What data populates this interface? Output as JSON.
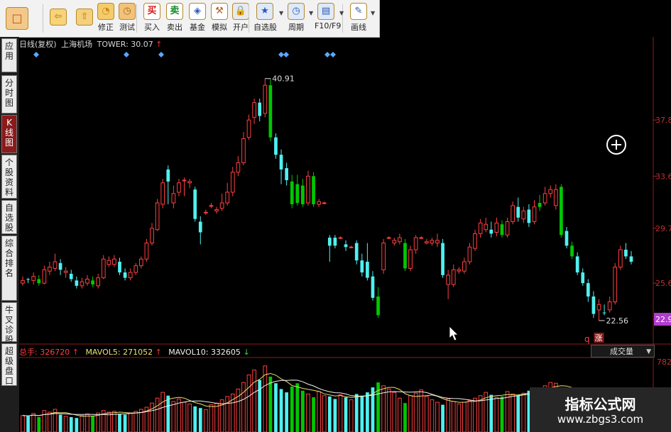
{
  "toolbar": {
    "buttons": [
      {
        "label": "",
        "icon": "home-icon"
      },
      {
        "label": "",
        "icon": "back-arrow-icon"
      },
      {
        "label": "",
        "icon": "up-down-arrows-icon"
      },
      {
        "label": "修正",
        "icon": "correct-icon"
      },
      {
        "label": "测试",
        "icon": "test-clock-icon"
      },
      {
        "label": "买入",
        "icon": "buy-icon"
      },
      {
        "label": "卖出",
        "icon": "sell-icon"
      },
      {
        "label": "基金",
        "icon": "fund-icon"
      },
      {
        "label": "模拟",
        "icon": "simulate-hammer-icon"
      },
      {
        "label": "开户",
        "icon": "lock-icon"
      },
      {
        "label": "自选股",
        "icon": "favorites-icon"
      },
      {
        "label": "周期",
        "icon": "period-icon"
      },
      {
        "label": "F10/F9",
        "icon": "f10-icon"
      },
      {
        "label": "画线",
        "icon": "pen-icon"
      }
    ]
  },
  "sidetabs": [
    {
      "label": "应用"
    },
    {
      "label": "分时图"
    },
    {
      "label": "K线图"
    },
    {
      "label": "个股资料"
    },
    {
      "label": "自选股"
    },
    {
      "label": "综合排名"
    },
    {
      "label": "牛叉诊股"
    },
    {
      "label": "超级盘口"
    }
  ],
  "chart_header": {
    "period_label": "日线(复权)",
    "stock_name": "上海机场",
    "indicator_text": "TOWER: 30.07",
    "indicator_arrow": "↑"
  },
  "price_axis": {
    "labels": [
      "37.8",
      "33.6",
      "29.7",
      "25.6",
      "22.9"
    ],
    "current_price_color": "#b23ccf"
  },
  "annotations": {
    "high_label": "40.91",
    "low_label": "22.56",
    "up_marker": "涨",
    "q_marker": "q"
  },
  "volume_header": {
    "total_label": "总手:",
    "total_value": "326720",
    "total_arrow": "↑",
    "mavol5_label": "MAVOL5:",
    "mavol5_value": "271052",
    "mavol5_arrow": "↑",
    "mavol10_label": "MAVOL10:",
    "mavol10_value": "332605",
    "mavol10_arrow": "↓",
    "dropdown": "成交量",
    "axis_value": "782"
  },
  "watermark": {
    "title": "指标公式网",
    "url": "www.zbgs3.com"
  },
  "colors": {
    "up": "#ff4040",
    "down_cyan": "#50f0f0",
    "down_green": "#00c800",
    "ma_yellow": "#e8e070",
    "ma_white": "#f0f0f0"
  },
  "chart_data": {
    "type": "candlestick",
    "ylim": [
      22,
      42
    ],
    "candles": [
      [
        25.6,
        25.8,
        26.1,
        25.4,
        "red"
      ],
      [
        25.9,
        25.9,
        26.0,
        25.6,
        "cyan"
      ],
      [
        25.8,
        26.1,
        26.4,
        25.5,
        "red"
      ],
      [
        25.9,
        25.6,
        26.2,
        25.4,
        "green"
      ],
      [
        25.6,
        26.6,
        26.9,
        25.5,
        "red"
      ],
      [
        26.5,
        26.8,
        27.2,
        26.2,
        "red"
      ],
      [
        26.7,
        27.2,
        27.8,
        26.5,
        "red"
      ],
      [
        27.1,
        26.6,
        27.4,
        26.2,
        "cyan"
      ],
      [
        26.5,
        26.4,
        26.8,
        26.0,
        "red"
      ],
      [
        26.3,
        25.9,
        26.6,
        25.7,
        "cyan"
      ],
      [
        25.8,
        25.4,
        26.1,
        25.2,
        "cyan"
      ],
      [
        25.4,
        25.7,
        26.0,
        25.2,
        "red"
      ],
      [
        25.6,
        25.9,
        26.2,
        25.4,
        "red"
      ],
      [
        25.8,
        25.5,
        26.1,
        25.3,
        "green"
      ],
      [
        25.4,
        26.0,
        26.3,
        25.2,
        "red"
      ],
      [
        26.0,
        27.4,
        27.7,
        25.9,
        "red"
      ],
      [
        27.3,
        27.0,
        27.6,
        26.8,
        "red"
      ],
      [
        27.0,
        27.4,
        27.7,
        26.8,
        "red"
      ],
      [
        27.2,
        26.4,
        27.5,
        26.2,
        "cyan"
      ],
      [
        26.4,
        26.0,
        26.7,
        25.8,
        "cyan"
      ],
      [
        26.0,
        26.4,
        26.7,
        25.8,
        "red"
      ],
      [
        26.4,
        26.9,
        27.1,
        26.2,
        "red"
      ],
      [
        26.9,
        27.4,
        27.6,
        26.7,
        "red"
      ],
      [
        27.4,
        28.6,
        28.9,
        27.2,
        "red"
      ],
      [
        28.6,
        29.7,
        30.1,
        28.4,
        "red"
      ],
      [
        29.6,
        31.6,
        31.9,
        29.5,
        "red"
      ],
      [
        31.5,
        33.1,
        33.4,
        31.2,
        "red"
      ],
      [
        33.2,
        34.1,
        34.4,
        31.5,
        "cyan"
      ],
      [
        32.3,
        31.6,
        32.9,
        31.2,
        "red"
      ],
      [
        32.4,
        33.1,
        33.4,
        32.1,
        "red"
      ],
      [
        33.3,
        33.3,
        33.5,
        32.1,
        "red"
      ],
      [
        33.2,
        33.1,
        33.4,
        32.7,
        "red"
      ],
      [
        32.6,
        30.4,
        32.8,
        30.2,
        "cyan"
      ],
      [
        30.2,
        29.4,
        30.6,
        28.5,
        "cyan"
      ],
      [
        30.9,
        30.9,
        31.1,
        30.7,
        "red"
      ],
      [
        31.4,
        31.4,
        31.6,
        31.2,
        "red"
      ],
      [
        31.0,
        31.1,
        31.3,
        30.8,
        "red"
      ],
      [
        31.2,
        31.6,
        32.3,
        31.0,
        "red"
      ],
      [
        31.6,
        32.4,
        33.1,
        31.4,
        "red"
      ],
      [
        32.4,
        33.9,
        34.3,
        32.1,
        "red"
      ],
      [
        33.9,
        34.6,
        35.1,
        33.6,
        "red"
      ],
      [
        34.6,
        36.4,
        36.9,
        34.4,
        "red"
      ],
      [
        36.5,
        37.8,
        38.2,
        36.3,
        "red"
      ],
      [
        38.0,
        39.1,
        39.4,
        37.5,
        "red"
      ],
      [
        39.1,
        38.1,
        39.4,
        37.7,
        "cyan"
      ],
      [
        38.3,
        40.4,
        40.9,
        38.0,
        "red"
      ],
      [
        40.4,
        36.5,
        40.9,
        36.2,
        "green"
      ],
      [
        36.5,
        35.2,
        36.8,
        34.9,
        "cyan"
      ],
      [
        35.2,
        34.1,
        35.6,
        33.0,
        "cyan"
      ],
      [
        34.2,
        33.3,
        34.6,
        32.9,
        "cyan"
      ],
      [
        33.2,
        31.5,
        33.7,
        31.2,
        "green"
      ],
      [
        31.6,
        33.0,
        33.7,
        31.4,
        "green"
      ],
      [
        32.9,
        31.5,
        33.4,
        31.3,
        "green"
      ],
      [
        31.6,
        33.6,
        34.0,
        31.4,
        "red"
      ],
      [
        33.6,
        31.5,
        33.9,
        31.3,
        "green"
      ],
      [
        31.5,
        31.7,
        31.9,
        31.3,
        "red"
      ],
      [
        31.6,
        31.6,
        31.7,
        31.5,
        "red"
      ],
      [
        29.0,
        28.4,
        29.2,
        27.2,
        "cyan"
      ],
      [
        28.4,
        29.0,
        29.2,
        28.2,
        "cyan"
      ],
      [
        29.0,
        29.0,
        29.1,
        28.9,
        "red"
      ],
      [
        28.5,
        28.3,
        28.8,
        28.0,
        "cyan"
      ],
      [
        28.3,
        28.3,
        28.4,
        28.2,
        "red"
      ],
      [
        28.6,
        27.3,
        28.8,
        27.0,
        "cyan"
      ],
      [
        27.3,
        26.4,
        27.8,
        26.1,
        "cyan"
      ],
      [
        27.2,
        26.0,
        28.6,
        25.8,
        "cyan"
      ],
      [
        26.1,
        24.5,
        26.5,
        24.3,
        "cyan"
      ],
      [
        24.6,
        23.2,
        25.3,
        23.0,
        "green"
      ],
      [
        26.6,
        28.6,
        28.9,
        26.3,
        "red"
      ],
      [
        29.0,
        29.0,
        29.1,
        28.9,
        "red"
      ],
      [
        28.8,
        28.6,
        29.0,
        28.4,
        "red"
      ],
      [
        28.7,
        29.0,
        29.3,
        28.5,
        "red"
      ],
      [
        28.6,
        26.7,
        28.9,
        26.5,
        "green"
      ],
      [
        26.7,
        28.1,
        28.4,
        26.5,
        "red"
      ],
      [
        28.1,
        29.0,
        29.2,
        27.8,
        "red"
      ],
      [
        29.0,
        29.0,
        29.1,
        28.9,
        "red"
      ],
      [
        28.7,
        28.6,
        28.9,
        28.5,
        "red"
      ],
      [
        28.6,
        28.8,
        29.0,
        28.4,
        "red"
      ],
      [
        28.8,
        28.6,
        29.3,
        28.3,
        "red"
      ],
      [
        28.6,
        26.2,
        28.9,
        26.0,
        "cyan"
      ],
      [
        26.2,
        25.5,
        26.6,
        24.4,
        "red"
      ],
      [
        25.5,
        26.6,
        27.0,
        25.3,
        "red"
      ],
      [
        26.6,
        26.5,
        26.8,
        26.3,
        "red"
      ],
      [
        26.5,
        27.2,
        27.5,
        26.3,
        "red"
      ],
      [
        27.2,
        28.3,
        28.6,
        27.0,
        "red"
      ],
      [
        28.2,
        29.3,
        29.6,
        28.0,
        "red"
      ],
      [
        29.3,
        30.1,
        30.4,
        29.0,
        "red"
      ],
      [
        30.0,
        29.6,
        30.5,
        29.4,
        "red"
      ],
      [
        29.6,
        29.3,
        30.2,
        29.0,
        "cyan"
      ],
      [
        29.4,
        30.1,
        30.5,
        29.1,
        "red"
      ],
      [
        30.0,
        29.2,
        30.3,
        29.0,
        "green"
      ],
      [
        29.2,
        30.2,
        30.5,
        29.0,
        "red"
      ],
      [
        30.2,
        31.4,
        31.7,
        30.0,
        "red"
      ],
      [
        31.3,
        30.5,
        32.0,
        30.2,
        "cyan"
      ],
      [
        30.4,
        31.0,
        31.3,
        30.1,
        "red"
      ],
      [
        31.1,
        30.1,
        31.5,
        29.8,
        "cyan"
      ],
      [
        30.2,
        31.3,
        31.8,
        30.0,
        "red"
      ],
      [
        31.3,
        31.6,
        32.2,
        31.0,
        "green"
      ],
      [
        31.6,
        32.3,
        32.8,
        31.4,
        "red"
      ],
      [
        32.3,
        32.6,
        32.9,
        32.0,
        "red"
      ],
      [
        32.6,
        31.4,
        33.0,
        31.1,
        "red"
      ],
      [
        32.8,
        29.2,
        33.0,
        29.0,
        "green"
      ],
      [
        29.5,
        28.4,
        29.8,
        28.2,
        "cyan"
      ],
      [
        28.4,
        27.6,
        28.7,
        27.4,
        "green"
      ],
      [
        27.6,
        26.4,
        27.9,
        26.2,
        "cyan"
      ],
      [
        26.4,
        25.6,
        26.7,
        25.4,
        "cyan"
      ],
      [
        25.6,
        24.6,
        25.9,
        24.2,
        "cyan"
      ],
      [
        24.6,
        23.3,
        25.0,
        23.0,
        "cyan"
      ],
      [
        23.6,
        24.0,
        24.4,
        22.8,
        "red"
      ],
      [
        23.4,
        23.4,
        24.0,
        23.2,
        "cyan"
      ],
      [
        23.6,
        24.2,
        24.6,
        23.4,
        "red"
      ],
      [
        24.2,
        26.8,
        27.1,
        24.0,
        "red"
      ],
      [
        26.8,
        28.1,
        28.4,
        26.6,
        "red"
      ],
      [
        28.1,
        27.6,
        28.6,
        27.4,
        "cyan"
      ],
      [
        27.6,
        27.2,
        28.0,
        27.0,
        "cyan"
      ]
    ],
    "volume": [
      40,
      38,
      45,
      36,
      52,
      48,
      55,
      42,
      38,
      36,
      34,
      40,
      44,
      38,
      46,
      52,
      48,
      50,
      44,
      42,
      46,
      50,
      55,
      60,
      70,
      82,
      96,
      88,
      74,
      80,
      72,
      68,
      62,
      58,
      54,
      66,
      70,
      78,
      86,
      92,
      104,
      120,
      138,
      150,
      126,
      160,
      134,
      118,
      104,
      96,
      110,
      118,
      100,
      92,
      84,
      98,
      88,
      86,
      80,
      90,
      84,
      78,
      92,
      88,
      96,
      108,
      120,
      112,
      104,
      96,
      82,
      70,
      88,
      94,
      102,
      86,
      78,
      72,
      66,
      80,
      74,
      68,
      72,
      76,
      82,
      88,
      96,
      90,
      84,
      86,
      98,
      92,
      88,
      94,
      100,
      96,
      104,
      112,
      120,
      118,
      106,
      100,
      94,
      88,
      82,
      78,
      84,
      92,
      98,
      104,
      96,
      90
    ]
  }
}
